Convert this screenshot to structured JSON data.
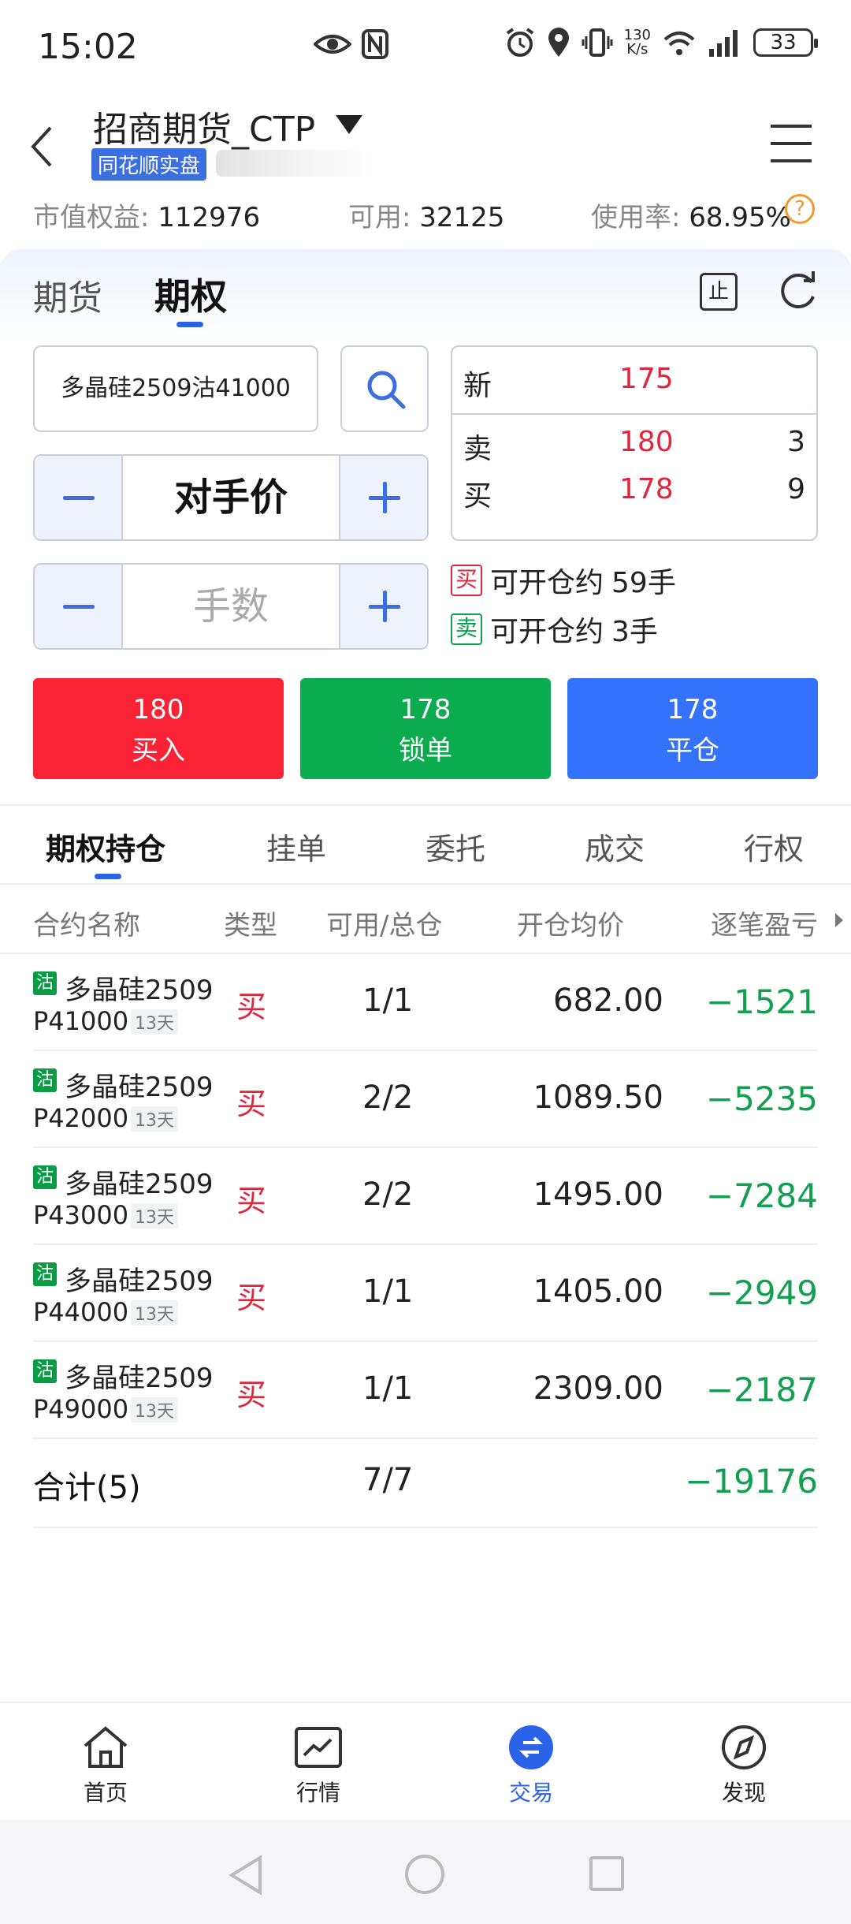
{
  "status_bar": {
    "time": "15:02",
    "net_speed_value": "130",
    "net_speed_unit": "K/s",
    "signal_label": "6",
    "battery": "33"
  },
  "header": {
    "broker_name": "招商期货_CTP",
    "account_badge": "同花顺实盘"
  },
  "summary": {
    "equity_label": "市值权益:",
    "equity_value": "112976",
    "available_label": "可用:",
    "available_value": "32125",
    "usage_label": "使用率:",
    "usage_value": "68.95%",
    "help_glyph": "?"
  },
  "trade_tabs": {
    "futures": "期货",
    "options": "期权",
    "stop_glyph": "止"
  },
  "order_form": {
    "contract": "多晶硅2509沽41000",
    "price_mode": "对手价",
    "qty_placeholder": "手数"
  },
  "quote": {
    "last_label": "新",
    "last_price": "175",
    "ask_label": "卖",
    "ask_price": "180",
    "ask_vol": "3",
    "bid_label": "买",
    "bid_price": "178",
    "bid_vol": "9"
  },
  "open_capacity": {
    "buy_tag": "买",
    "buy_text": "可开仓约",
    "buy_value": "59手",
    "sell_tag": "卖",
    "sell_text": "可开仓约",
    "sell_value": "3手"
  },
  "actions": {
    "buy_price": "180",
    "buy_label": "买入",
    "lock_price": "178",
    "lock_label": "锁单",
    "close_price": "178",
    "close_label": "平仓"
  },
  "position_tabs": [
    "期权持仓",
    "挂单",
    "委托",
    "成交",
    "行权"
  ],
  "table": {
    "headers": [
      "合约名称",
      "类型",
      "可用/总仓",
      "开仓均价",
      "逐笔盈亏"
    ],
    "rows": [
      {
        "exch": "沽",
        "name": "多晶硅2509",
        "strike": "P41000",
        "days": "13天",
        "type": "买",
        "qty": "1/1",
        "avg": "682.00",
        "pnl": "−1521"
      },
      {
        "exch": "沽",
        "name": "多晶硅2509",
        "strike": "P42000",
        "days": "13天",
        "type": "买",
        "qty": "2/2",
        "avg": "1089.50",
        "pnl": "−5235"
      },
      {
        "exch": "沽",
        "name": "多晶硅2509",
        "strike": "P43000",
        "days": "13天",
        "type": "买",
        "qty": "2/2",
        "avg": "1495.00",
        "pnl": "−7284"
      },
      {
        "exch": "沽",
        "name": "多晶硅2509",
        "strike": "P44000",
        "days": "13天",
        "type": "买",
        "qty": "1/1",
        "avg": "1405.00",
        "pnl": "−2949"
      },
      {
        "exch": "沽",
        "name": "多晶硅2509",
        "strike": "P49000",
        "days": "13天",
        "type": "买",
        "qty": "1/1",
        "avg": "2309.00",
        "pnl": "−2187"
      }
    ],
    "total_label": "合计(5)",
    "total_qty": "7/7",
    "total_pnl": "−19176"
  },
  "bottom_nav": {
    "home": "首页",
    "market": "行情",
    "trade": "交易",
    "discover": "发现"
  },
  "colors": {
    "accent": "#2b63e8",
    "buy": "#fa2336",
    "lock": "#0aac4f",
    "close": "#3572fb",
    "loss": "#12a050"
  }
}
